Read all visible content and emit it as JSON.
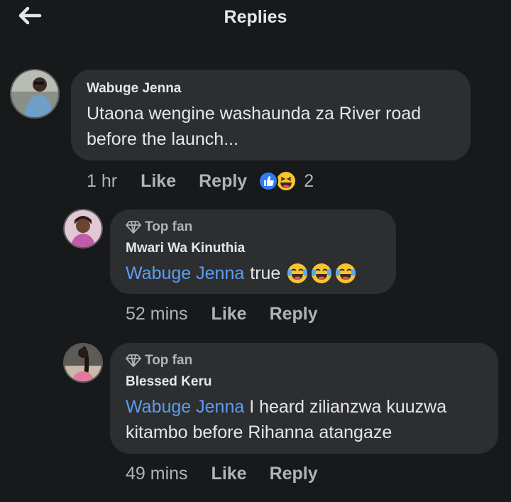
{
  "header": {
    "title": "Replies"
  },
  "comments": [
    {
      "author": "Wabuge Jenna",
      "text": "Utaona wengine washaunda za River road before the launch...",
      "text_line1": "Utaona wengine washaunda za River road",
      "text_line2": "before the launch...",
      "time": "1 hr",
      "like_label": "Like",
      "reply_label": "Reply",
      "reactions": {
        "icons": [
          "like-icon",
          "laugh-icon"
        ],
        "count": "2"
      }
    },
    {
      "badge": "Top fan",
      "author": "Mwari Wa Kinuthia",
      "mention": "Wabuge Jenna",
      "text": "true",
      "emojis": [
        "crying-laughing-emoji",
        "crying-laughing-emoji",
        "crying-laughing-emoji"
      ],
      "time": "52 mins",
      "like_label": "Like",
      "reply_label": "Reply"
    },
    {
      "badge": "Top fan",
      "author": "Blessed Keru",
      "mention": "Wabuge Jenna",
      "text_line1": "I heard zilianzwa kuuzwa",
      "text_line2": "kitambo before Rihanna atangaze",
      "time": "49 mins",
      "like_label": "Like",
      "reply_label": "Reply"
    }
  ],
  "colors": {
    "background": "#18191a",
    "bubble": "#2d2e30",
    "mention": "#5b9df0",
    "secondary_text": "#b0b3b8"
  }
}
